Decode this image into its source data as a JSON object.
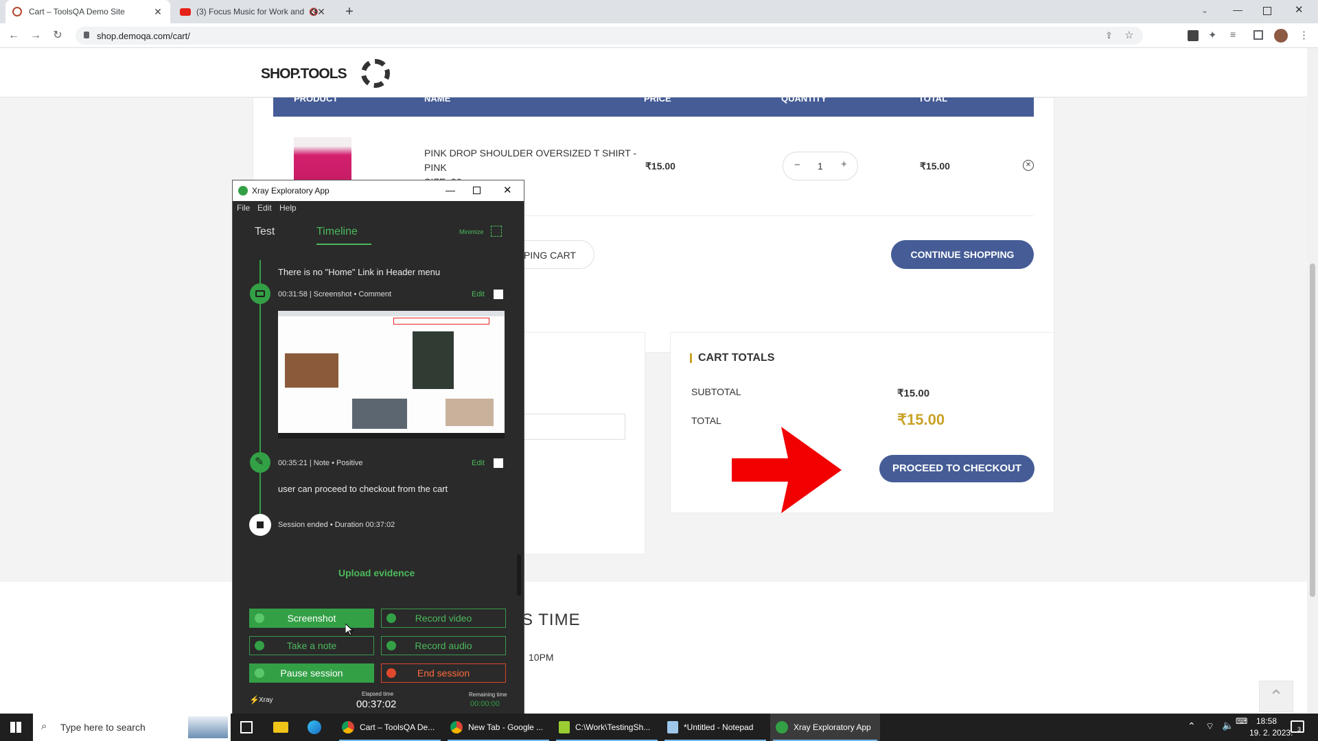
{
  "browser": {
    "tabs": [
      {
        "title": "Cart – ToolsQA Demo Site",
        "active": true
      },
      {
        "title": "(3) Focus Music for Work and",
        "active": false
      }
    ],
    "new_tab": "+",
    "url": "shop.demoqa.com/cart/"
  },
  "site": {
    "logo_text": "SHOP.TOOLS",
    "table_headers": [
      "PRODUCT",
      "NAME",
      "PRICE",
      "QUANTITY",
      "TOTAL"
    ],
    "cart_item": {
      "name_line1": "PINK DROP SHOULDER OVERSIZED T SHIRT -",
      "name_line2": "PINK",
      "size": "SIZE: 36",
      "price": "₹15.00",
      "qty_minus": "−",
      "quantity": "1",
      "qty_plus": "+",
      "total": "₹15.00"
    },
    "update_cart_label": "PING CART",
    "continue_shopping": "CONTINUE SHOPPING",
    "cart_totals": {
      "heading": "CART TOTALS",
      "subtotal_label": "SUBTOTAL",
      "subtotal_value": "₹15.00",
      "total_label": "TOTAL",
      "total_value": "₹15.00",
      "checkout": "PROCEED TO CHECKOUT"
    },
    "footer_heading_fragment": "S TIME",
    "footer_time_fragment": "10PM",
    "accent_color": "#455c96",
    "gold_color": "#c9a227"
  },
  "xray": {
    "title": "Xray Exploratory App",
    "menu": [
      "File",
      "Edit",
      "Help"
    ],
    "tabs": [
      "Test",
      "Timeline"
    ],
    "active_tab": "Timeline",
    "minimize_label": "Minimize",
    "entries": {
      "prev_text": "There is no \"Home\" Link in Header menu",
      "screenshot_meta": "00:31:58 | Screenshot • Comment",
      "note_meta": "00:35:21 | Note • Positive",
      "note_text": "user can proceed to checkout from the cart",
      "session_ended": "Session ended • Duration 00:37:02",
      "edit_label": "Edit"
    },
    "upload_evidence": "Upload evidence",
    "buttons": {
      "screenshot": "Screenshot",
      "record_video": "Record video",
      "take_note": "Take a note",
      "record_audio": "Record audio",
      "pause_session": "Pause session",
      "end_session": "End session"
    },
    "footer": {
      "brand": "Xray",
      "elapsed_label": "Elapsed time",
      "elapsed_value": "00:37:02",
      "remaining_label": "Remaining time",
      "remaining_value": "00:00:00"
    },
    "green": "#33a046"
  },
  "taskbar": {
    "search_placeholder": "Type here to search",
    "apps": [
      "Cart – ToolsQA De...",
      "New Tab - Google ...",
      "C:\\Work\\TestingSh...",
      "*Untitled - Notepad",
      "Xray Exploratory App"
    ],
    "time": "18:58",
    "date": "19. 2. 2023.",
    "notifications": "3"
  }
}
